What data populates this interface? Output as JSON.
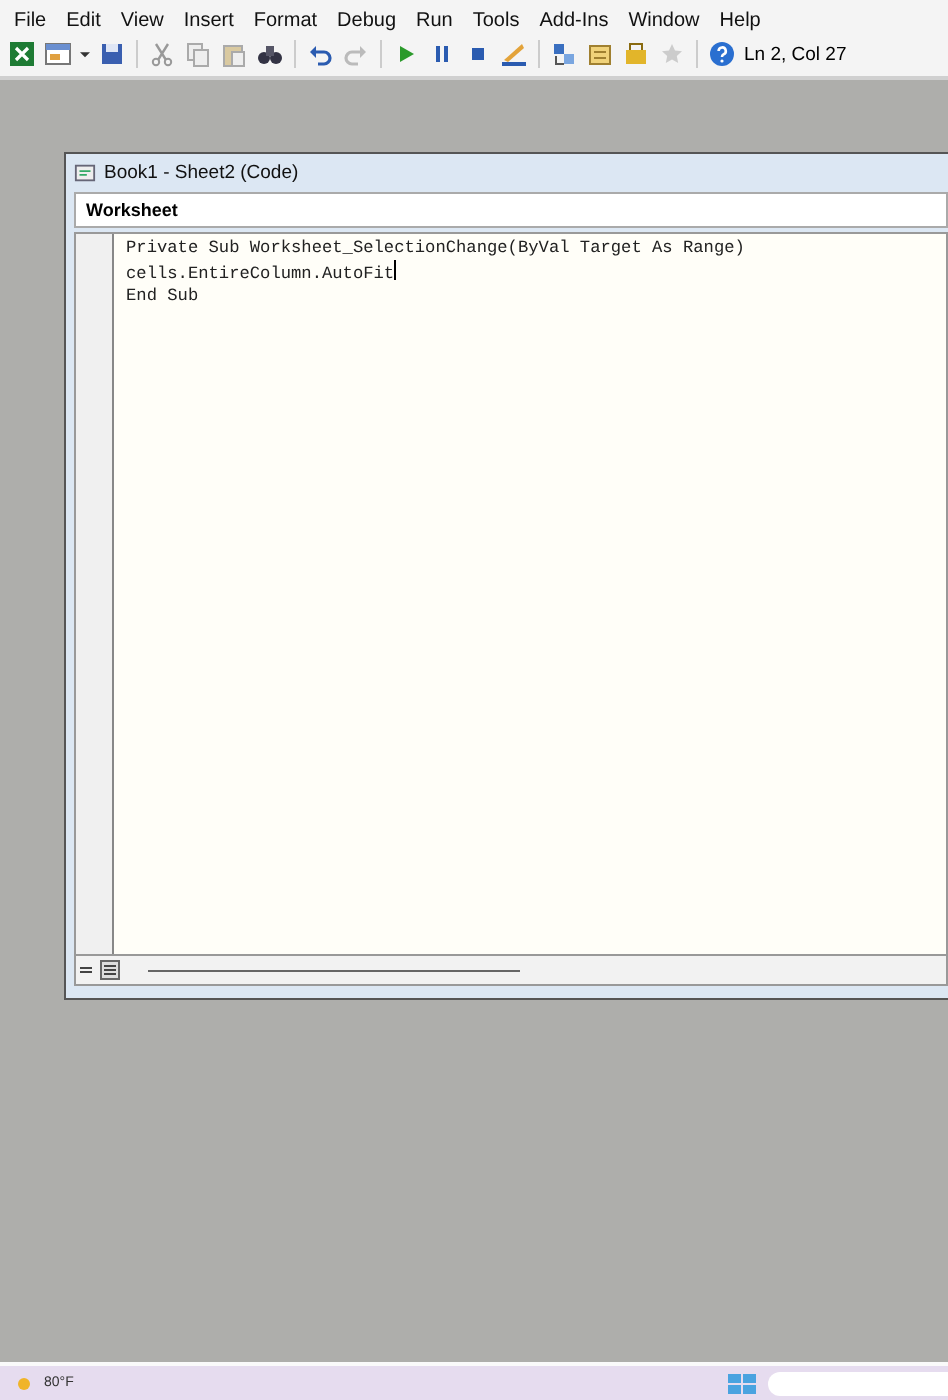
{
  "menu": [
    "File",
    "Edit",
    "View",
    "Insert",
    "Format",
    "Debug",
    "Run",
    "Tools",
    "Add-Ins",
    "Window",
    "Help"
  ],
  "toolbar": {
    "icons": [
      {
        "kind": "excel"
      },
      {
        "kind": "form"
      },
      {
        "kind": "save"
      },
      {
        "kind": "sep"
      },
      {
        "kind": "cut"
      },
      {
        "kind": "copy"
      },
      {
        "kind": "paste"
      },
      {
        "kind": "find"
      },
      {
        "kind": "sep"
      },
      {
        "kind": "undo"
      },
      {
        "kind": "redo"
      },
      {
        "kind": "sep"
      },
      {
        "kind": "run"
      },
      {
        "kind": "pause"
      },
      {
        "kind": "stop"
      },
      {
        "kind": "design"
      },
      {
        "kind": "sep"
      },
      {
        "kind": "project"
      },
      {
        "kind": "properties"
      },
      {
        "kind": "toolbox"
      },
      {
        "kind": "object"
      },
      {
        "kind": "sep"
      },
      {
        "kind": "help"
      }
    ],
    "position": "Ln 2, Col 27"
  },
  "code_window": {
    "title": "Book1 - Sheet2 (Code)",
    "object_box": "Worksheet",
    "lines": [
      {
        "text": "Private Sub Worksheet_SelectionChange(ByVal Target As Range)",
        "has_cursor": false
      },
      {
        "text": "cells.EntireColumn.AutoFit",
        "has_cursor": true
      },
      {
        "text": "End Sub",
        "has_cursor": false
      }
    ]
  },
  "taskbar": {
    "weather": "80°F"
  }
}
